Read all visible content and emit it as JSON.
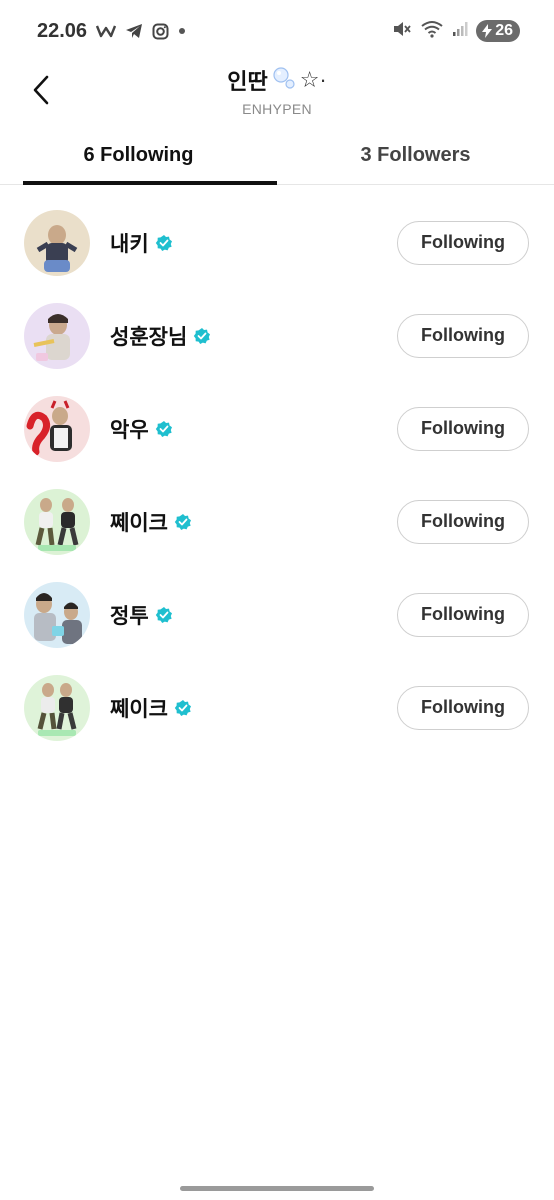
{
  "status_bar": {
    "time": "22.06",
    "notification_icons": [
      "w-app-icon",
      "telegram-icon",
      "instagram-icon",
      "dot-icon"
    ],
    "battery_level": "26"
  },
  "header": {
    "title": "인딴",
    "title_decoration": "☆·",
    "subtitle": "ENHYPEN"
  },
  "tabs": [
    {
      "label": "6 Following",
      "active": true
    },
    {
      "label": "3 Followers",
      "active": false
    }
  ],
  "following": [
    {
      "name": "내키",
      "verified": true,
      "button_label": "Following",
      "avatar_color": "#e9dcc6"
    },
    {
      "name": "성훈장님",
      "verified": true,
      "button_label": "Following",
      "avatar_color": "#e8ddf2"
    },
    {
      "name": "악우",
      "verified": true,
      "button_label": "Following",
      "avatar_color": "#f4dcdc"
    },
    {
      "name": "쩨이크",
      "verified": true,
      "button_label": "Following",
      "avatar_color": "#d9f0d3"
    },
    {
      "name": "정투",
      "verified": true,
      "button_label": "Following",
      "avatar_color": "#d6e9f3"
    },
    {
      "name": "쩨이크",
      "verified": true,
      "button_label": "Following",
      "avatar_color": "#dcf1d6"
    }
  ],
  "colors": {
    "verified_badge": "#1fbfcf",
    "tab_indicator": "#111111",
    "button_border": "#cfcfcf"
  }
}
